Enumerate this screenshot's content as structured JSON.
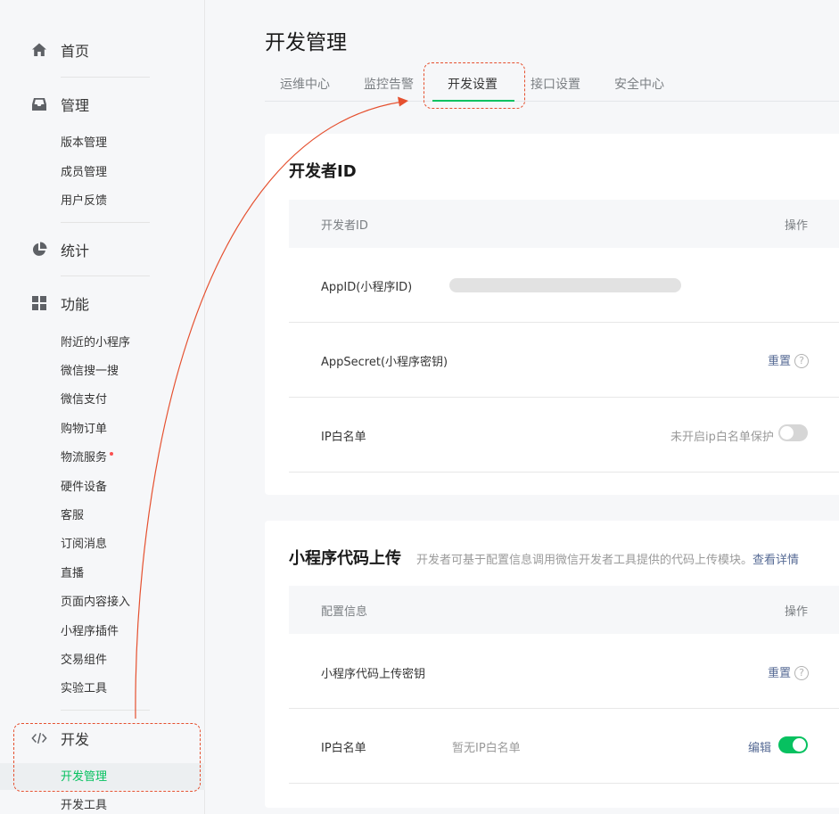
{
  "sidebar": {
    "home": "首页",
    "manage": {
      "label": "管理",
      "items": [
        "版本管理",
        "成员管理",
        "用户反馈"
      ]
    },
    "stats": "统计",
    "features": {
      "label": "功能",
      "items": [
        "附近的小程序",
        "微信搜一搜",
        "微信支付",
        "购物订单",
        "物流服务",
        "硬件设备",
        "客服",
        "订阅消息",
        "直播",
        "页面内容接入",
        "小程序插件",
        "交易组件",
        "实验工具"
      ]
    },
    "dev": {
      "label": "开发",
      "items": [
        "开发管理",
        "开发工具"
      ],
      "active_item": "开发管理"
    }
  },
  "page": {
    "title": "开发管理",
    "tabs": [
      "运维中心",
      "监控告警",
      "开发设置",
      "接口设置",
      "安全中心"
    ],
    "active_tab": "开发设置"
  },
  "developer_id": {
    "title": "开发者ID",
    "columns": [
      "开发者ID",
      "操作"
    ],
    "rows": {
      "appid": {
        "label": "AppID(小程序ID)"
      },
      "secret": {
        "label": "AppSecret(小程序密钥)",
        "action": "重置"
      },
      "ip": {
        "label": "IP白名单",
        "status": "未开启ip白名单保护",
        "toggle_on": false
      }
    }
  },
  "upload": {
    "title": "小程序代码上传",
    "desc": "开发者可基于配置信息调用微信开发者工具提供的代码上传模块。",
    "desc_link": "查看详情",
    "columns": [
      "配置信息",
      "操作"
    ],
    "rows": {
      "key": {
        "label": "小程序代码上传密钥",
        "action": "重置"
      },
      "ip": {
        "label": "IP白名单",
        "value": "暂无IP白名单",
        "action": "编辑",
        "toggle_on": true
      }
    }
  },
  "help_glyph": "?",
  "colors": {
    "accent": "#07c160",
    "link": "#576b95",
    "annotation": "#e5502f"
  }
}
